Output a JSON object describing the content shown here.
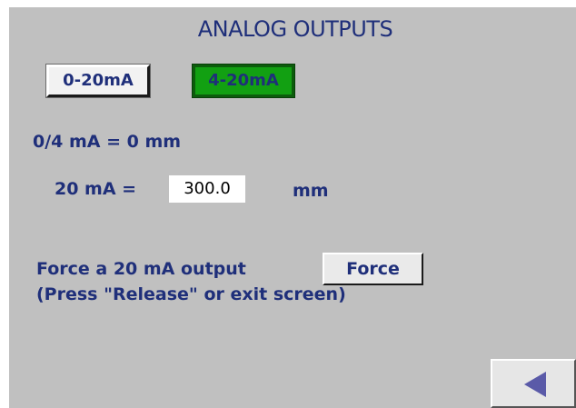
{
  "title": "ANALOG OUTPUTS",
  "range_buttons": {
    "option_0_20": "0-20mA",
    "option_4_20": "4-20mA",
    "selected": "4-20mA",
    "selected_color": "#12a012"
  },
  "zero_point": {
    "label": "0/4 mA = 0  mm"
  },
  "full_scale": {
    "label": "20 mA =",
    "value": "300.0",
    "unit": "mm"
  },
  "force": {
    "line1": "Force a 20 mA output",
    "line2": "(Press \"Release\" or exit screen)",
    "button_label": "Force"
  },
  "navigation": {
    "back_icon": "left-triangle-arrow",
    "icon_color": "#5a5aa8"
  },
  "colors": {
    "background": "#c0c0c0",
    "text": "#1f2f7a"
  }
}
